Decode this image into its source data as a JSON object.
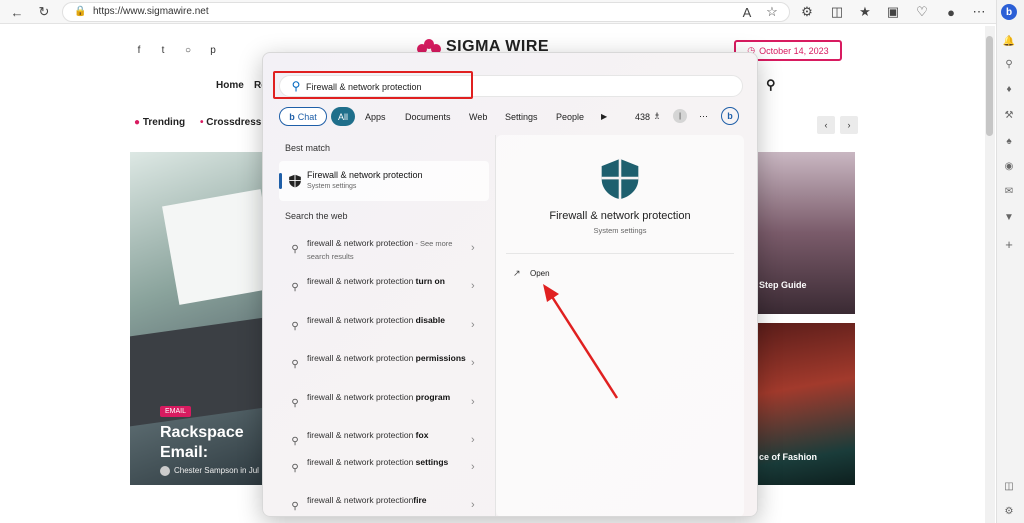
{
  "browser": {
    "url": "https://www.sigmawire.net",
    "icons": {
      "back": "back-arrow-icon",
      "refresh": "refresh-icon",
      "lock": "lock-icon"
    }
  },
  "site": {
    "logo": "SIGMA WIRE",
    "date": "October 14, 2023",
    "nav": {
      "home": "Home",
      "partial": "Re"
    },
    "trending_label": "Trending",
    "trending_item": "Crossdressing",
    "hero": {
      "tag": "EMAIL",
      "title": "Rackspace Email: Effortless Com",
      "author_name": "Chester Sampson",
      "author_in": "in Jul"
    },
    "right1_caption": "Step Guide",
    "right2_caption": "ce of Fashion"
  },
  "search": {
    "query": "Firewall & network protection",
    "filters": {
      "chat": "Chat",
      "all": "All",
      "apps": "Apps",
      "documents": "Documents",
      "web": "Web",
      "settings": "Settings",
      "people": "People",
      "count": "438"
    },
    "best_match_label": "Best match",
    "best_match": {
      "title": "Firewall & network protection",
      "subtitle": "System settings"
    },
    "web_label": "Search the web",
    "web_items": [
      {
        "prefix": "firewall & network protection",
        "bold": "",
        "suffix": " - See more search results"
      },
      {
        "prefix": "firewall & network protection ",
        "bold": "turn on",
        "suffix": ""
      },
      {
        "prefix": "firewall & network protection ",
        "bold": "disable",
        "suffix": ""
      },
      {
        "prefix": "firewall & network protection ",
        "bold": "permissions",
        "suffix": ""
      },
      {
        "prefix": "firewall & network protection ",
        "bold": "program",
        "suffix": ""
      },
      {
        "prefix": "firewall & network protection ",
        "bold": "fox",
        "suffix": ""
      },
      {
        "prefix": "firewall & network protection ",
        "bold": "settings",
        "suffix": ""
      },
      {
        "prefix": "firewall & network protection",
        "bold": "fire",
        "suffix": ""
      }
    ],
    "detail": {
      "title": "Firewall & network protection",
      "subtitle": "System settings",
      "open_label": "Open"
    }
  },
  "colors": {
    "accent": "#1f6f8b",
    "shield": "#1e5f6e",
    "highlight": "#e02020",
    "brand": "#d81b60"
  }
}
